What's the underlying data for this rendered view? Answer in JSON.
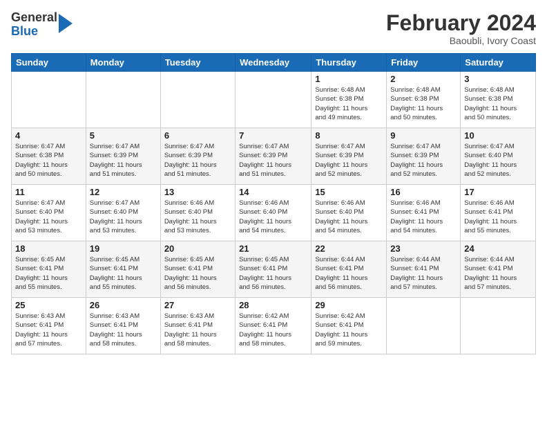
{
  "header": {
    "logo_general": "General",
    "logo_blue": "Blue",
    "month_title": "February 2024",
    "subtitle": "Baoubli, Ivory Coast"
  },
  "weekdays": [
    "Sunday",
    "Monday",
    "Tuesday",
    "Wednesday",
    "Thursday",
    "Friday",
    "Saturday"
  ],
  "weeks": [
    [
      {
        "day": "",
        "info": ""
      },
      {
        "day": "",
        "info": ""
      },
      {
        "day": "",
        "info": ""
      },
      {
        "day": "",
        "info": ""
      },
      {
        "day": "1",
        "info": "Sunrise: 6:48 AM\nSunset: 6:38 PM\nDaylight: 11 hours\nand 49 minutes."
      },
      {
        "day": "2",
        "info": "Sunrise: 6:48 AM\nSunset: 6:38 PM\nDaylight: 11 hours\nand 50 minutes."
      },
      {
        "day": "3",
        "info": "Sunrise: 6:48 AM\nSunset: 6:38 PM\nDaylight: 11 hours\nand 50 minutes."
      }
    ],
    [
      {
        "day": "4",
        "info": "Sunrise: 6:47 AM\nSunset: 6:38 PM\nDaylight: 11 hours\nand 50 minutes."
      },
      {
        "day": "5",
        "info": "Sunrise: 6:47 AM\nSunset: 6:39 PM\nDaylight: 11 hours\nand 51 minutes."
      },
      {
        "day": "6",
        "info": "Sunrise: 6:47 AM\nSunset: 6:39 PM\nDaylight: 11 hours\nand 51 minutes."
      },
      {
        "day": "7",
        "info": "Sunrise: 6:47 AM\nSunset: 6:39 PM\nDaylight: 11 hours\nand 51 minutes."
      },
      {
        "day": "8",
        "info": "Sunrise: 6:47 AM\nSunset: 6:39 PM\nDaylight: 11 hours\nand 52 minutes."
      },
      {
        "day": "9",
        "info": "Sunrise: 6:47 AM\nSunset: 6:39 PM\nDaylight: 11 hours\nand 52 minutes."
      },
      {
        "day": "10",
        "info": "Sunrise: 6:47 AM\nSunset: 6:40 PM\nDaylight: 11 hours\nand 52 minutes."
      }
    ],
    [
      {
        "day": "11",
        "info": "Sunrise: 6:47 AM\nSunset: 6:40 PM\nDaylight: 11 hours\nand 53 minutes."
      },
      {
        "day": "12",
        "info": "Sunrise: 6:47 AM\nSunset: 6:40 PM\nDaylight: 11 hours\nand 53 minutes."
      },
      {
        "day": "13",
        "info": "Sunrise: 6:46 AM\nSunset: 6:40 PM\nDaylight: 11 hours\nand 53 minutes."
      },
      {
        "day": "14",
        "info": "Sunrise: 6:46 AM\nSunset: 6:40 PM\nDaylight: 11 hours\nand 54 minutes."
      },
      {
        "day": "15",
        "info": "Sunrise: 6:46 AM\nSunset: 6:40 PM\nDaylight: 11 hours\nand 54 minutes."
      },
      {
        "day": "16",
        "info": "Sunrise: 6:46 AM\nSunset: 6:41 PM\nDaylight: 11 hours\nand 54 minutes."
      },
      {
        "day": "17",
        "info": "Sunrise: 6:46 AM\nSunset: 6:41 PM\nDaylight: 11 hours\nand 55 minutes."
      }
    ],
    [
      {
        "day": "18",
        "info": "Sunrise: 6:45 AM\nSunset: 6:41 PM\nDaylight: 11 hours\nand 55 minutes."
      },
      {
        "day": "19",
        "info": "Sunrise: 6:45 AM\nSunset: 6:41 PM\nDaylight: 11 hours\nand 55 minutes."
      },
      {
        "day": "20",
        "info": "Sunrise: 6:45 AM\nSunset: 6:41 PM\nDaylight: 11 hours\nand 56 minutes."
      },
      {
        "day": "21",
        "info": "Sunrise: 6:45 AM\nSunset: 6:41 PM\nDaylight: 11 hours\nand 56 minutes."
      },
      {
        "day": "22",
        "info": "Sunrise: 6:44 AM\nSunset: 6:41 PM\nDaylight: 11 hours\nand 56 minutes."
      },
      {
        "day": "23",
        "info": "Sunrise: 6:44 AM\nSunset: 6:41 PM\nDaylight: 11 hours\nand 57 minutes."
      },
      {
        "day": "24",
        "info": "Sunrise: 6:44 AM\nSunset: 6:41 PM\nDaylight: 11 hours\nand 57 minutes."
      }
    ],
    [
      {
        "day": "25",
        "info": "Sunrise: 6:43 AM\nSunset: 6:41 PM\nDaylight: 11 hours\nand 57 minutes."
      },
      {
        "day": "26",
        "info": "Sunrise: 6:43 AM\nSunset: 6:41 PM\nDaylight: 11 hours\nand 58 minutes."
      },
      {
        "day": "27",
        "info": "Sunrise: 6:43 AM\nSunset: 6:41 PM\nDaylight: 11 hours\nand 58 minutes."
      },
      {
        "day": "28",
        "info": "Sunrise: 6:42 AM\nSunset: 6:41 PM\nDaylight: 11 hours\nand 58 minutes."
      },
      {
        "day": "29",
        "info": "Sunrise: 6:42 AM\nSunset: 6:41 PM\nDaylight: 11 hours\nand 59 minutes."
      },
      {
        "day": "",
        "info": ""
      },
      {
        "day": "",
        "info": ""
      }
    ]
  ]
}
